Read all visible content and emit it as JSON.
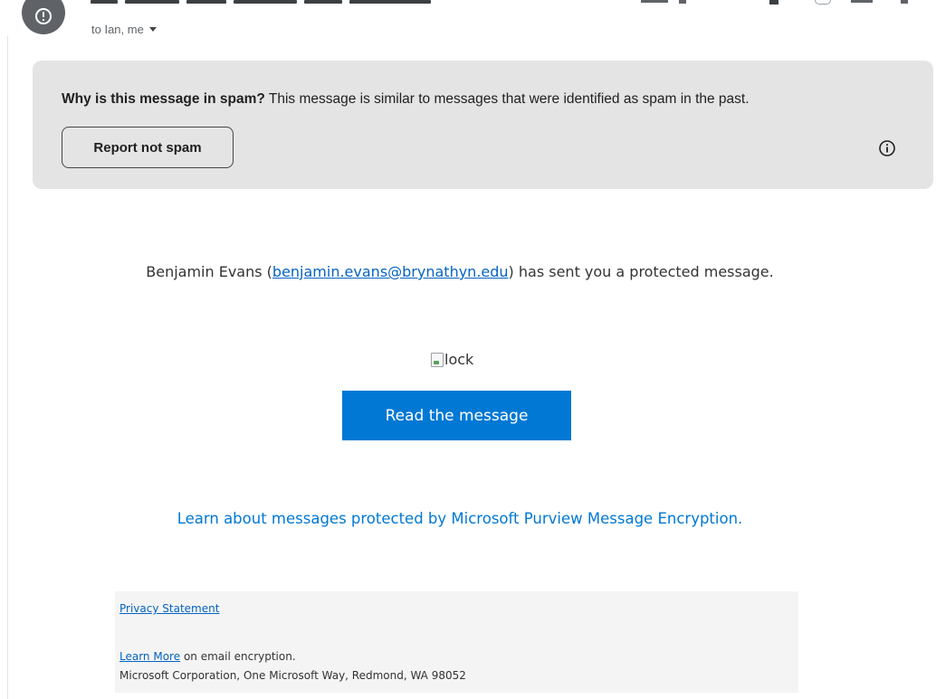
{
  "header": {
    "recipients_label": "to Ian, me",
    "avatar_icon": "alert-icon"
  },
  "spam_banner": {
    "question": "Why is this message in spam?",
    "explanation": "This message is similar to messages that were identified as spam in the past.",
    "report_button_label": "Report not spam",
    "info_icon": "info-icon",
    "background": "#e4e4e4"
  },
  "message": {
    "sender_name": "Benjamin Evans",
    "sender_email": "benjamin.evans@brynathyn.edu",
    "sent_text_suffix": "has sent you a protected message.",
    "lock_image_alt": "lock",
    "read_button_label": "Read the message",
    "learn_link_text": "Learn about messages protected by Microsoft Purview Message Encryption.",
    "accent": "#0078d4"
  },
  "footer": {
    "privacy_link": "Privacy Statement",
    "learn_more_link": "Learn More",
    "learn_more_suffix": "on email encryption.",
    "address": "Microsoft Corporation, One Microsoft Way, Redmond, WA 98052"
  }
}
